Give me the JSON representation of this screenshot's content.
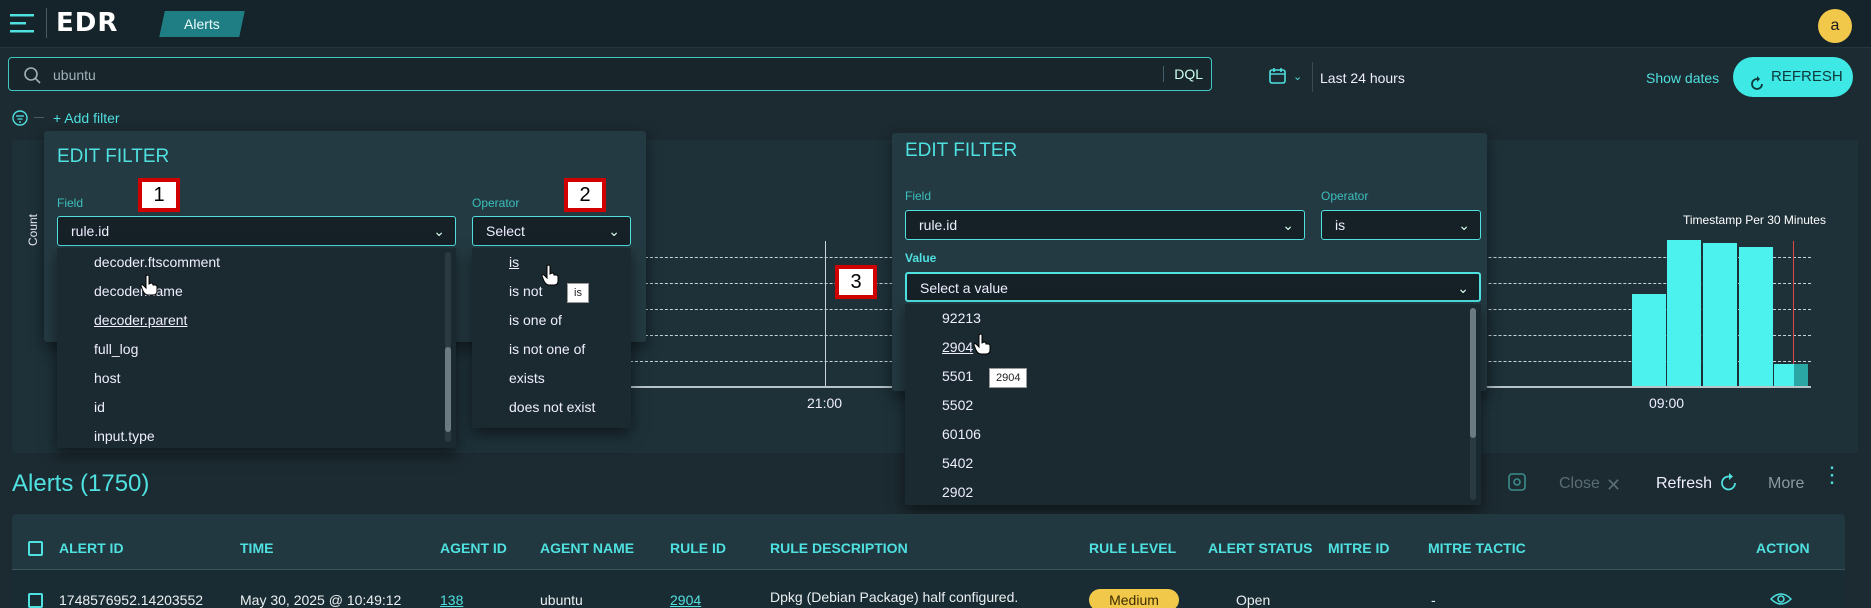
{
  "app": {
    "logo": "EDR",
    "breadcrumb": "Alerts",
    "avatar": "a"
  },
  "search": {
    "value": "ubuntu",
    "dql": "DQL"
  },
  "date": {
    "range": "Last 24 hours",
    "show_dates": "Show dates",
    "refresh": "REFRESH"
  },
  "filter": {
    "add": "+ Add filter"
  },
  "chart": {
    "title": "Timestamp Per 30 Minutes",
    "ylabel": "Count",
    "tick_21": "21:00",
    "tick_09": "09:00"
  },
  "chart_data": {
    "type": "bar",
    "xlabel": "Timestamp Per 30 Minutes",
    "ylabel": "Count",
    "x_ticks": [
      "21:00",
      "09:00"
    ],
    "values": [
      0.63,
      1.0,
      0.98,
      0.95,
      0.15,
      0.15
    ],
    "grid": true
  },
  "edit1": {
    "title": "EDIT FILTER",
    "field_label": "Field",
    "field_value": "rule.id",
    "operator_label": "Operator",
    "operator_value": "Select",
    "field_options": [
      "decoder.ftscomment",
      "decoder.name",
      "decoder.parent",
      "full_log",
      "host",
      "id",
      "input.type"
    ],
    "operator_options": [
      "is",
      "is not",
      "is one of",
      "is not one of",
      "exists",
      "does not exist"
    ],
    "tooltip": "is"
  },
  "edit2": {
    "title": "EDIT FILTER",
    "field_label": "Field",
    "field_value": "rule.id",
    "operator_label": "Operator",
    "operator_value": "is",
    "value_label": "Value",
    "value_placeholder": "Select a value",
    "value_options": [
      "92213",
      "2904",
      "5501",
      "5502",
      "60106",
      "5402",
      "2902"
    ],
    "tooltip": "2904"
  },
  "markers": [
    "1",
    "2",
    "3"
  ],
  "alerts": {
    "title": "Alerts (1750)",
    "actions": {
      "close": "Close",
      "refresh": "Refresh",
      "more": "More"
    },
    "columns": [
      "ALERT ID",
      "TIME",
      "AGENT ID",
      "AGENT NAME",
      "RULE ID",
      "RULE DESCRIPTION",
      "RULE LEVEL",
      "ALERT STATUS",
      "MITRE ID",
      "MITRE TACTIC",
      "ACTION"
    ],
    "row": {
      "alert_id": "1748576952.14203552",
      "time": "May 30, 2025 @ 10:49:12",
      "agent_id": "138",
      "agent_name": "ubuntu",
      "rule_id": "2904",
      "rule_description": "Dpkg (Debian Package) half configured.",
      "rule_level": "Medium",
      "alert_status": "Open",
      "mitre_tactic": "-"
    }
  },
  "colors": {
    "accent": "#4fe0e0",
    "background": "#1c2a31",
    "medium_badge": "#f2c84b",
    "marker_border": "#d00000"
  }
}
